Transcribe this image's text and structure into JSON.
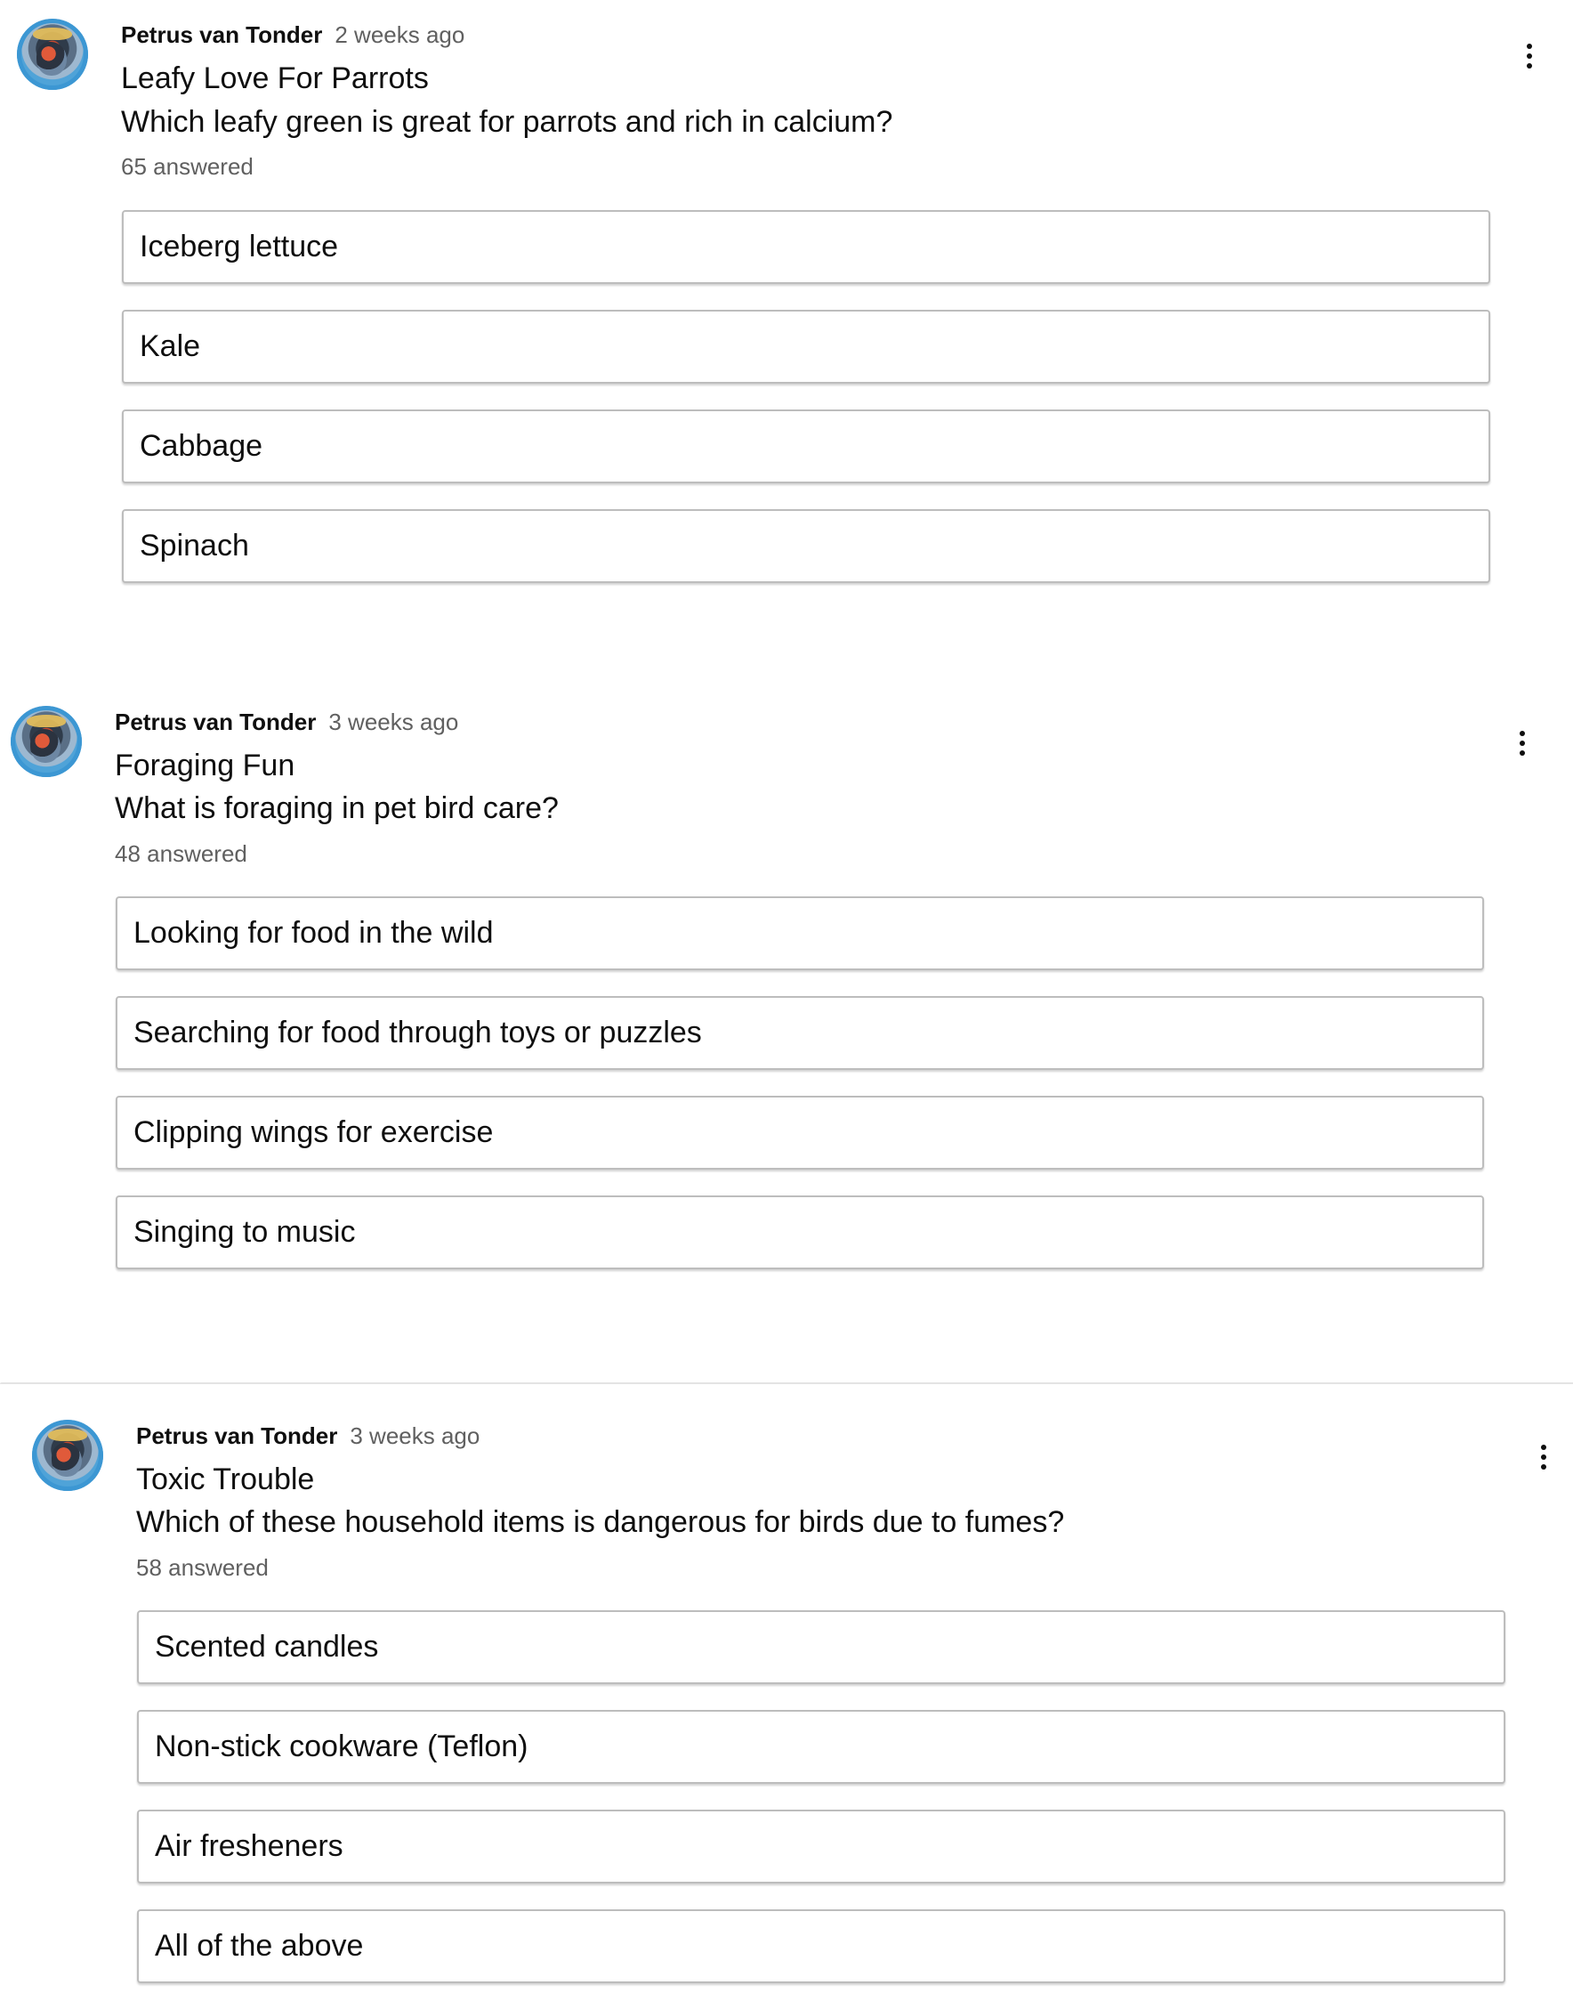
{
  "posts": [
    {
      "author": "Petrus van Tonder",
      "time": "2 weeks ago",
      "title": "Leafy Love For Parrots",
      "question": "Which leafy green is great for parrots and rich in calcium?",
      "answered": "65 answered",
      "options": [
        "Iceberg lettuce",
        "Kale",
        "Cabbage",
        "Spinach"
      ]
    },
    {
      "author": "Petrus van Tonder",
      "time": "3 weeks ago",
      "title": "Foraging Fun",
      "question": "What is foraging in pet bird care?",
      "answered": "48 answered",
      "options": [
        "Looking for food in the wild",
        "Searching for food through toys or puzzles",
        "Clipping wings for exercise",
        "Singing to music"
      ]
    },
    {
      "author": "Petrus van Tonder",
      "time": "3 weeks ago",
      "title": "Toxic Trouble",
      "question": "Which of these household items is dangerous for birds due to fumes?",
      "answered": "58 answered",
      "options": [
        "Scented candles",
        "Non-stick cookware (Teflon)",
        "Air fresheners",
        "All of the above"
      ]
    }
  ],
  "icons": {
    "avatar": "parrot-avatar",
    "menu": "more-vert-icon"
  }
}
